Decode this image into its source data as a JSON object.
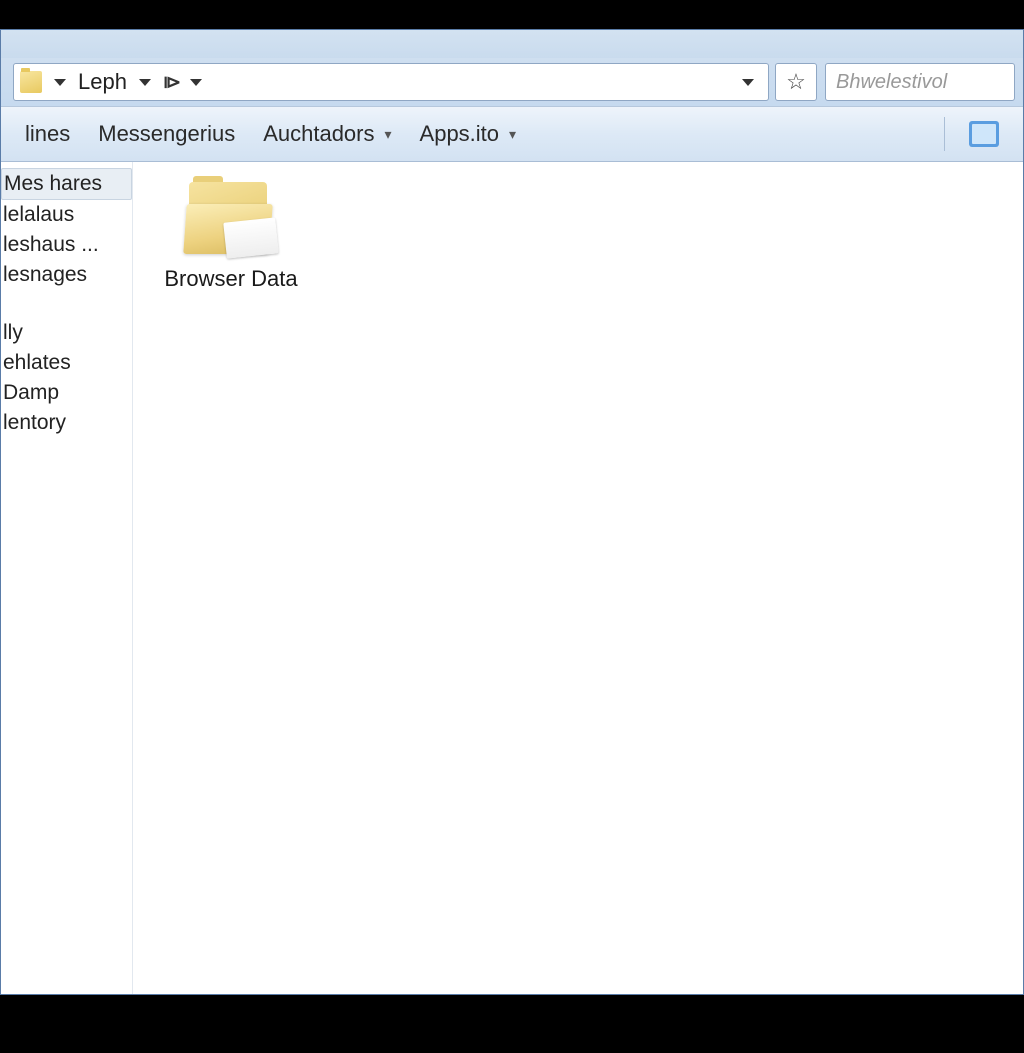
{
  "address": {
    "crumb": "Leph"
  },
  "search": {
    "placeholder": "Bhwelestivol"
  },
  "toolbar": {
    "items": [
      {
        "label": "lines",
        "dropdown": false
      },
      {
        "label": "Messengerius",
        "dropdown": false
      },
      {
        "label": "Auchtadors",
        "dropdown": true
      },
      {
        "label": "Apps.ito",
        "dropdown": true
      }
    ]
  },
  "sidebar": {
    "group1": [
      {
        "label": "Mes hares",
        "selected": true
      },
      {
        "label": "lelalaus",
        "selected": false
      },
      {
        "label": "leshaus ...",
        "selected": false
      },
      {
        "label": "lesnages",
        "selected": false
      }
    ],
    "group2": [
      {
        "label": "lly"
      },
      {
        "label": "ehlates"
      },
      {
        "label": "Damp"
      },
      {
        "label": "lentory"
      }
    ]
  },
  "main": {
    "items": [
      {
        "name": "Browser Data",
        "type": "folder"
      }
    ]
  }
}
